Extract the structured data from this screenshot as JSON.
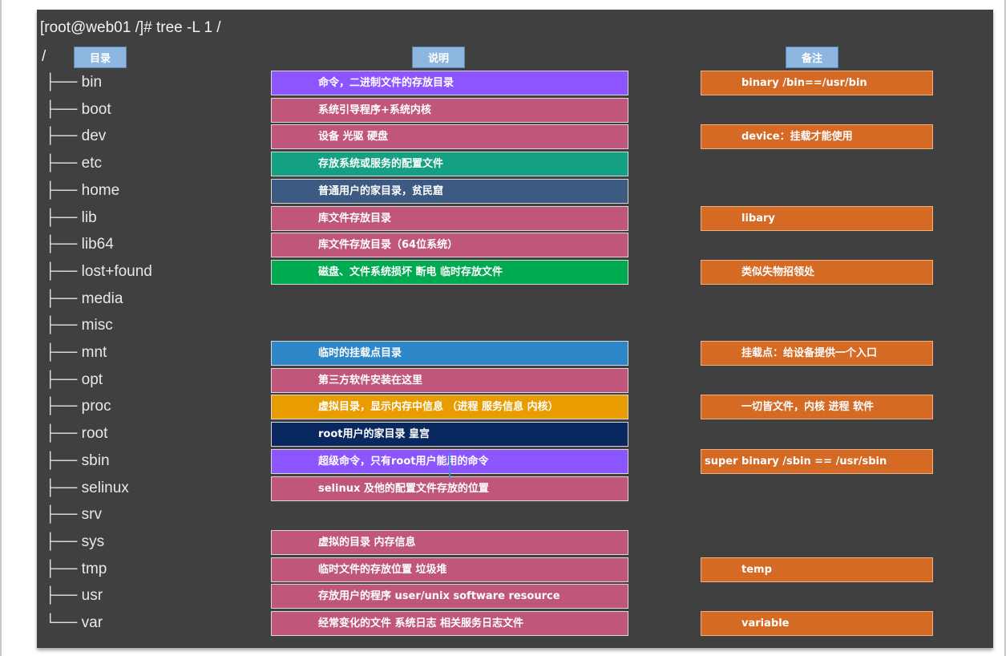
{
  "command": "[root@web01 /]# tree -L 1 /",
  "root": "/",
  "headers": {
    "dir": "目录",
    "desc": "说明",
    "note": "备注"
  },
  "colors": {
    "terminal_bg": "#404040",
    "header": "#8db6e0",
    "note": "#d46a24"
  },
  "rows": [
    {
      "dir": "├── bin",
      "desc": "命令，二进制文件的存放目录",
      "desc_color": "#8c55ff",
      "note": "binary /bin==/usr/bin"
    },
    {
      "dir": "├── boot",
      "desc": "系统引导程序+系统内核",
      "desc_color": "#c0567b",
      "note": ""
    },
    {
      "dir": "├── dev",
      "desc": "设备 光驱 硬盘",
      "desc_color": "#c0567b",
      "note": "device：挂载才能使用"
    },
    {
      "dir": "├── etc",
      "desc": "存放系统或服务的配置文件",
      "desc_color": "#14a082",
      "note": ""
    },
    {
      "dir": "├── home",
      "desc": "普通用户的家目录，贫民窟",
      "desc_color": "#3c5a82",
      "note": ""
    },
    {
      "dir": "├── lib",
      "desc": "库文件存放目录",
      "desc_color": "#c0567b",
      "note": "libary"
    },
    {
      "dir": "├── lib64",
      "desc": "库文件存放目录（64位系统）",
      "desc_color": "#c0567b",
      "note": ""
    },
    {
      "dir": "├── lost+found",
      "desc": "磁盘、文件系统损坏 断电 临时存放文件",
      "desc_color": "#00aa50",
      "note": "类似失物招领处"
    },
    {
      "dir": "├── media",
      "desc": "",
      "desc_color": "",
      "note": ""
    },
    {
      "dir": "├── misc",
      "desc": "",
      "desc_color": "",
      "note": ""
    },
    {
      "dir": "├── mnt",
      "desc": "临时的挂载点目录",
      "desc_color": "#2d86c8",
      "note": "挂载点：给设备提供一个入口"
    },
    {
      "dir": "├── opt",
      "desc": "第三方软件安装在这里",
      "desc_color": "#c0567b",
      "note": ""
    },
    {
      "dir": "├── proc",
      "desc": "虚拟目录，显示内存中信息 （进程 服务信息 内核）",
      "desc_color": "#e89c00",
      "note": "一切皆文件，内核 进程 软件"
    },
    {
      "dir": "├── root",
      "desc": "root用户的家目录 皇宫",
      "desc_color": "#0a2860",
      "note": ""
    },
    {
      "dir": "├── sbin",
      "desc": "超级命令，只有root用户能用的命令",
      "desc_color": "#8c55ff",
      "note": "super binary /sbin == /usr/sbin"
    },
    {
      "dir": "├── selinux",
      "desc": "selinux 及他的配置文件存放的位置",
      "desc_color": "#c0567b",
      "note": ""
    },
    {
      "dir": "├── srv",
      "desc": "",
      "desc_color": "",
      "note": ""
    },
    {
      "dir": "├── sys",
      "desc": "虚拟的目录 内存信息",
      "desc_color": "#c0567b",
      "note": ""
    },
    {
      "dir": "├── tmp",
      "desc": "临时文件的存放位置 垃圾堆",
      "desc_color": "#c0567b",
      "note": "temp"
    },
    {
      "dir": "├── usr",
      "desc": "存放用户的程序 user/unix software resource",
      "desc_color": "#c0567b",
      "note": ""
    },
    {
      "dir": "└── var",
      "desc": "经常变化的文件 系统日志 相关服务日志文件",
      "desc_color": "#c0567b",
      "note": "variable"
    }
  ]
}
